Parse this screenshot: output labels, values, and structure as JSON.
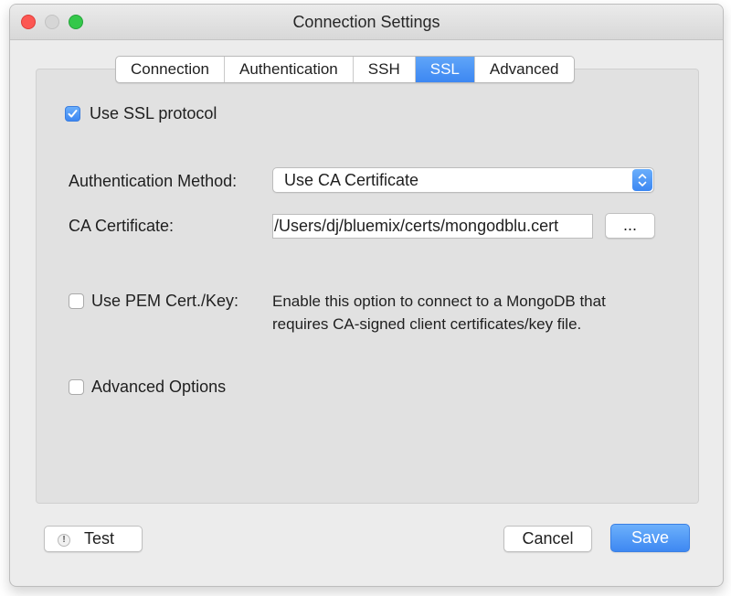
{
  "window": {
    "title": "Connection Settings"
  },
  "tabs": [
    {
      "label": "Connection",
      "active": false
    },
    {
      "label": "Authentication",
      "active": false
    },
    {
      "label": "SSH",
      "active": false
    },
    {
      "label": "SSL",
      "active": true
    },
    {
      "label": "Advanced",
      "active": false
    }
  ],
  "ssl": {
    "use_ssl_label": "Use SSL protocol",
    "use_ssl_checked": true,
    "auth_method_label": "Authentication Method:",
    "auth_method_value": "Use CA Certificate",
    "ca_cert_label": "CA Certificate:",
    "ca_cert_value": "/Users/dj/bluemix/certs/mongodblu.cert",
    "browse_label": "...",
    "pem_label": "Use PEM Cert./Key:",
    "pem_checked": false,
    "pem_description_line1": "Enable this option to connect to a MongoDB that",
    "pem_description_line2": "requires CA-signed client certificates/key file.",
    "advanced_options_label": "Advanced Options",
    "advanced_options_checked": false
  },
  "footer": {
    "test_label": "Test",
    "test_icon_glyph": "!",
    "cancel_label": "Cancel",
    "save_label": "Save"
  },
  "colors": {
    "accent": "#3d87f2",
    "close": "#fc5753",
    "maximize": "#34c84a"
  }
}
